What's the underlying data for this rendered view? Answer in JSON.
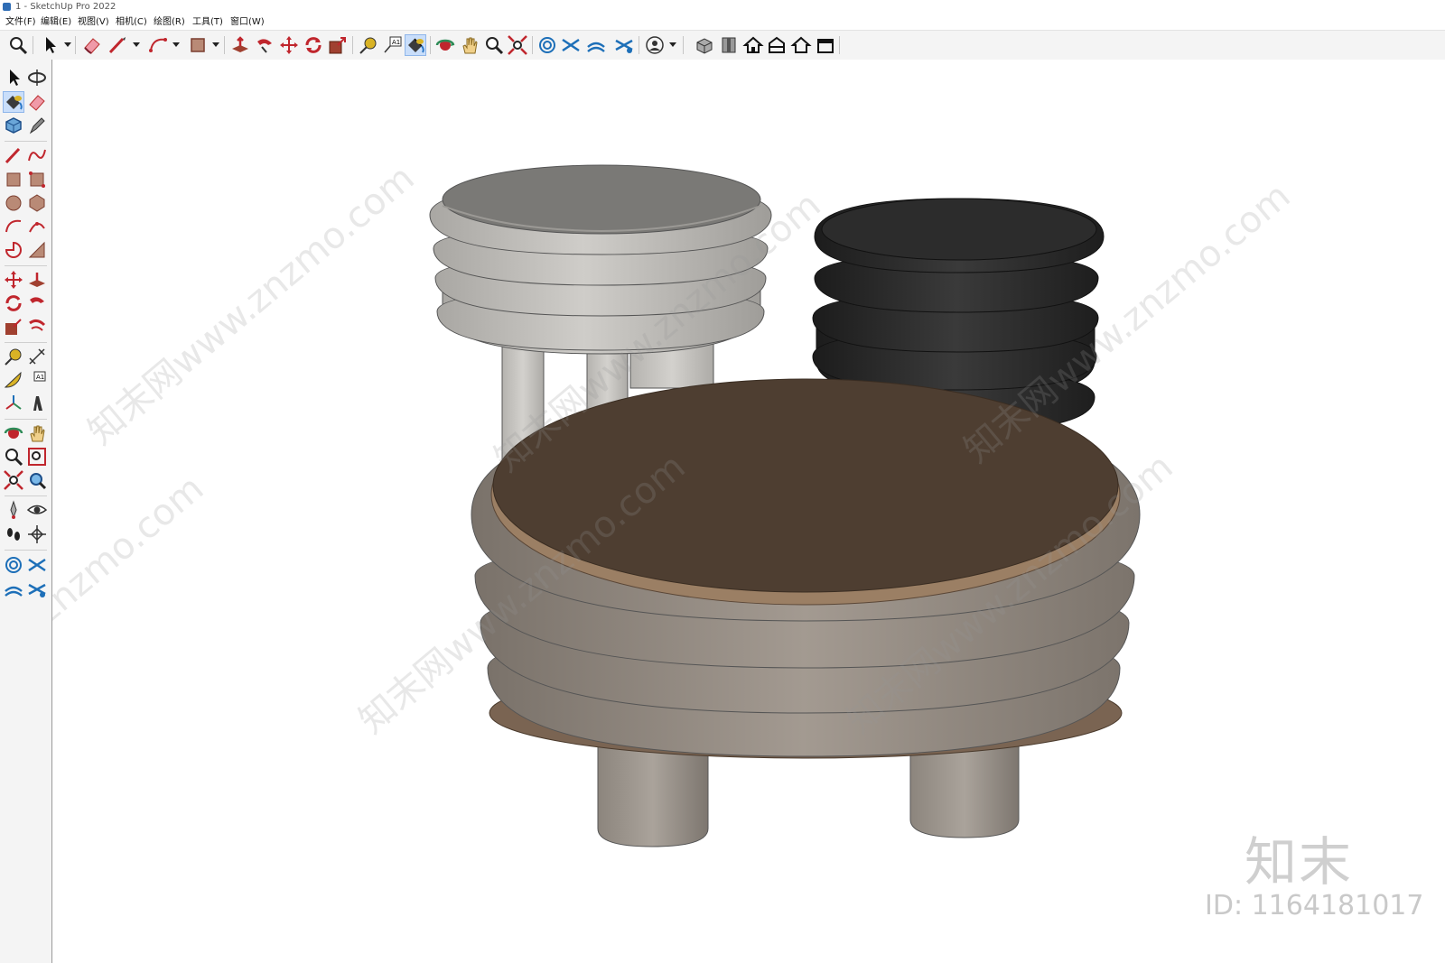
{
  "window": {
    "title": "1 - SketchUp Pro 2022"
  },
  "menu": [
    {
      "label": "文件(F)"
    },
    {
      "label": "编辑(E)"
    },
    {
      "label": "视图(V)"
    },
    {
      "label": "相机(C)"
    },
    {
      "label": "绘图(R)"
    },
    {
      "label": "工具(T)"
    },
    {
      "label": "窗口(W)"
    }
  ],
  "toolbar": {
    "tools": [
      "zoom-window",
      "select",
      "eraser",
      "line",
      "arc",
      "rectangle",
      "push-pull",
      "follow-me",
      "move",
      "rotate",
      "scale",
      "tape-measure",
      "text",
      "paint-bucket",
      "orbit",
      "pan",
      "zoom",
      "zoom-extents",
      "sandbox-from-contours",
      "sandbox-from-scratch",
      "smoove",
      "stamp",
      "user-profile",
      "iso-view",
      "top-view",
      "front-view",
      "right-view",
      "back-view",
      "left-view"
    ],
    "active": "paint-bucket"
  },
  "left_toolbar": {
    "tools": [
      "select",
      "orbit",
      "paint-bucket",
      "eraser",
      "component",
      "pencil-line",
      "line",
      "freehand",
      "rectangle",
      "rotated-rectangle",
      "circle",
      "polygon",
      "arc",
      "3-point-arc",
      "pie",
      "2-point-arc",
      "move",
      "push-pull",
      "rotate",
      "follow-me",
      "scale",
      "offset",
      "tape-measure",
      "dimension",
      "protractor",
      "text",
      "axes",
      "3d-text",
      "orbit",
      "pan",
      "zoom",
      "zoom-window",
      "zoom-extents",
      "previous-view",
      "position-camera",
      "look-around",
      "walk",
      "section-plane",
      "sandbox-contours",
      "sandbox-scratch",
      "smoove",
      "stamp"
    ],
    "active": "paint-bucket"
  },
  "watermark": {
    "text": "知末网www.znzmo.com",
    "text_short": "znzmo.com",
    "brand": "知末",
    "id": "ID: 1164181017"
  },
  "colors": {
    "toolbar_bg": "#f4f4f4",
    "active_tool": "#c9defa",
    "light_stool": "#c5c3bf",
    "light_stool_top": "#787774",
    "dark_stool": "#2b2b2b",
    "table_body": "#8f867d",
    "table_top": "#5c4a3a",
    "table_rim": "#9a8066"
  }
}
